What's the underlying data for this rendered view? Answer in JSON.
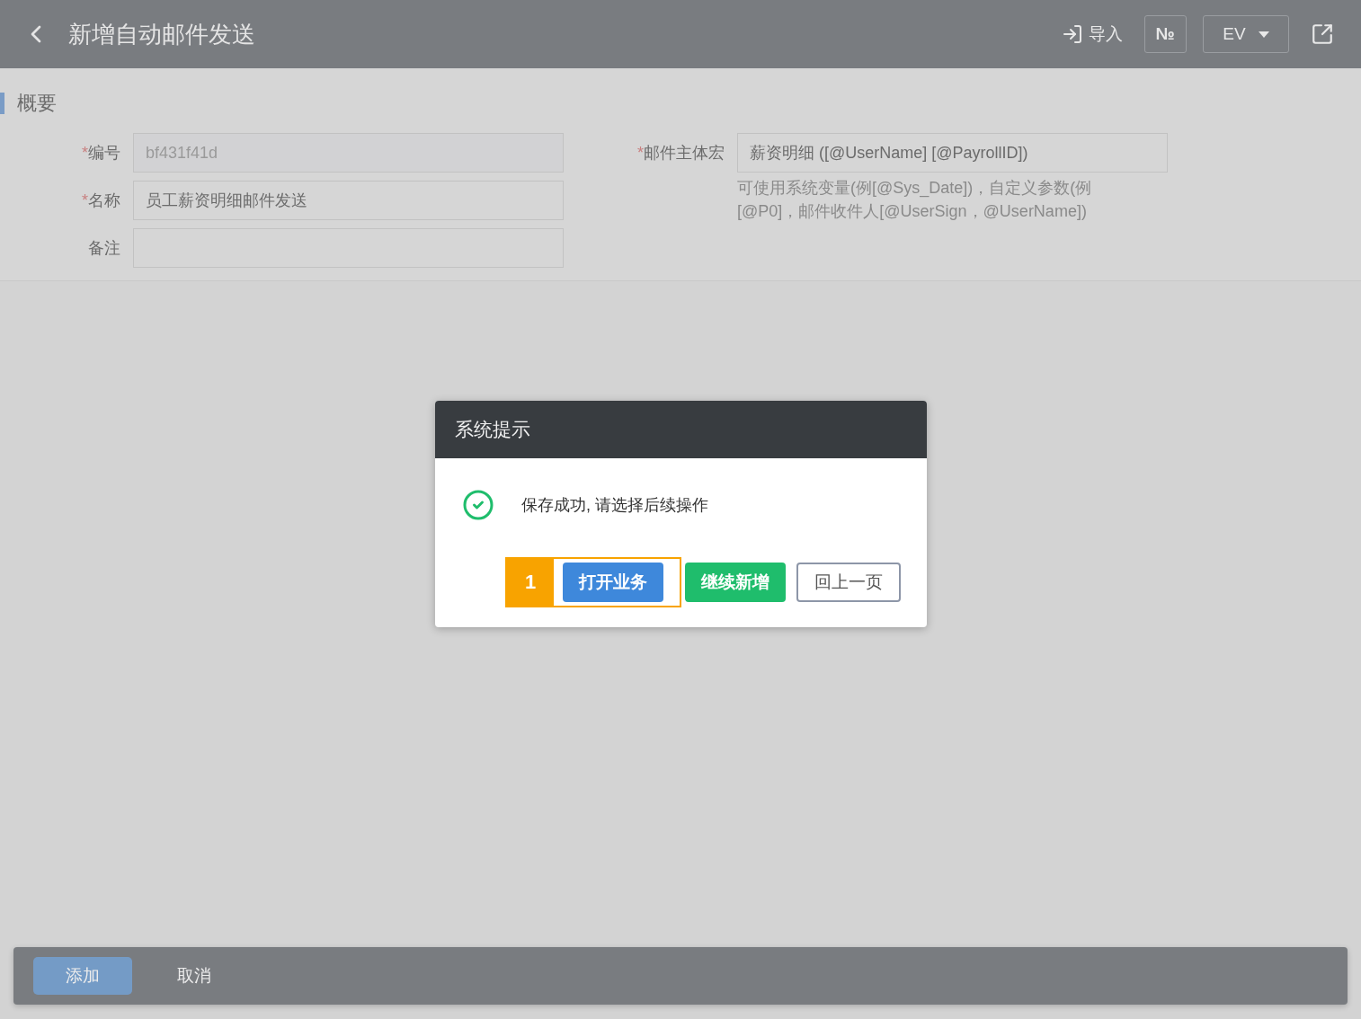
{
  "header": {
    "title": "新增自动邮件发送",
    "actions": [
      {
        "kind": "import",
        "label": "导入"
      },
      {
        "kind": "boxed",
        "label": "№"
      },
      {
        "kind": "dropdown",
        "label": "EV"
      },
      {
        "kind": "share"
      }
    ]
  },
  "section": {
    "title": "概要"
  },
  "left_fields": [
    {
      "mark": "*",
      "label": "编号",
      "value": "bf431f41d",
      "disabled": true
    },
    {
      "mark": "*",
      "label": "名称",
      "value": "员工薪资明细邮件发送"
    },
    {
      "label": "备注"
    }
  ],
  "right_field": {
    "mark": "*",
    "label": "邮件主体宏",
    "value": "薪资明细 ([@UserName] [@PayrollID])",
    "hint": "可使用系统变量(例[@Sys_Date])，自定义参数(例[@P0]，邮件收件人[@UserSign，@UserName])"
  },
  "dialog": {
    "title": "系统提示",
    "message": "保存成功, 请选择后续操作",
    "step_marker": "1",
    "buttons": [
      {
        "kind": "primary",
        "label": "打开业务",
        "highlighted": true
      },
      {
        "kind": "success",
        "label": "继续新增",
        "highlighted": false
      },
      {
        "kind": "default",
        "label": "回上一页",
        "highlighted": false
      }
    ]
  },
  "footer": {
    "buttons": [
      {
        "kind": "primary",
        "label": "添加"
      },
      {
        "kind": "plain",
        "label": "取消"
      }
    ]
  }
}
